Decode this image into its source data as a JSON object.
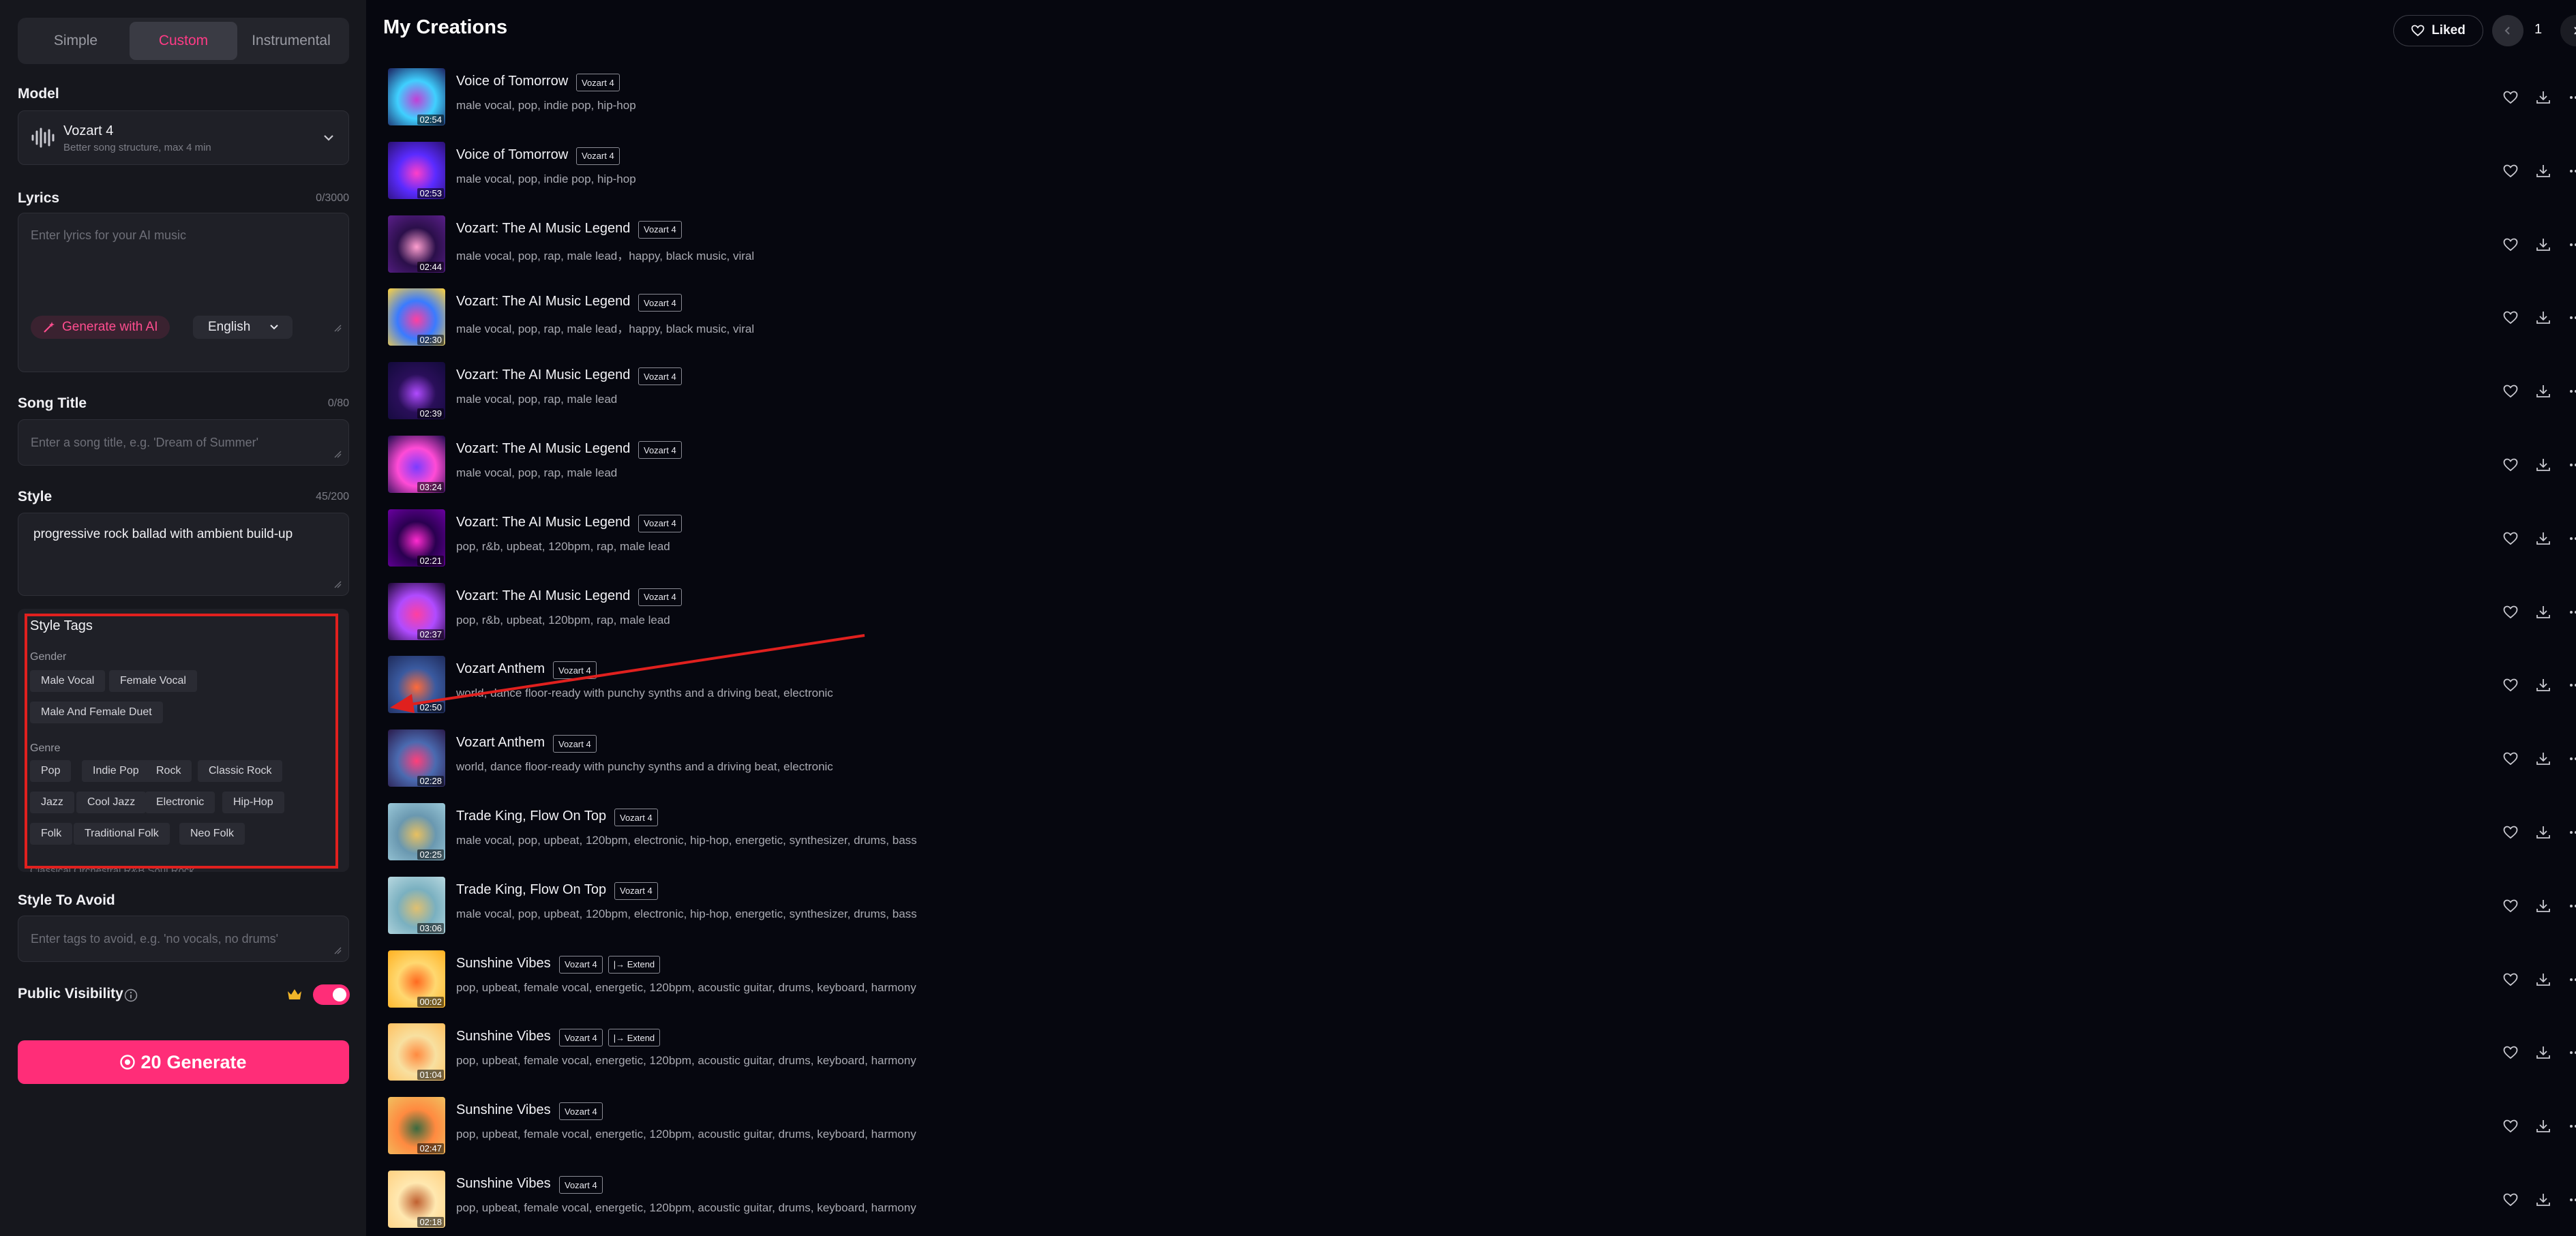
{
  "tabs": {
    "simple": "Simple",
    "custom": "Custom",
    "instrumental": "Instrumental"
  },
  "model": {
    "label": "Model",
    "name": "Vozart 4",
    "description": "Better song structure, max 4 min"
  },
  "lyrics": {
    "label": "Lyrics",
    "count": "0/3000",
    "placeholder": "Enter lyrics for your AI music",
    "generate_label": "Generate with AI",
    "language": "English"
  },
  "song_title": {
    "label": "Song Title",
    "count": "0/80",
    "placeholder": "Enter a song title, e.g. 'Dream of Summer'"
  },
  "style": {
    "label": "Style",
    "count": "45/200",
    "value": "progressive rock ballad with ambient build-up"
  },
  "style_tags": {
    "title": "Style Tags",
    "gender_label": "Gender",
    "gender": [
      "Male Vocal",
      "Female Vocal",
      "Male And Female Duet"
    ],
    "genre_label": "Genre",
    "genre": [
      "Pop",
      "Indie Pop",
      "Rock",
      "Classic Rock",
      "Jazz",
      "Cool Jazz",
      "Electronic",
      "Hip-Hop",
      "Folk",
      "Traditional Folk",
      "Neo Folk"
    ],
    "cut_off": "Classical   Orchestral   R&B   Soul   Rock"
  },
  "style_avoid": {
    "label": "Style To Avoid",
    "placeholder": "Enter tags to avoid, e.g. 'no vocals, no drums'"
  },
  "visibility": {
    "label": "Public Visibility",
    "enabled": true
  },
  "generate": {
    "credits": "20",
    "label": "Generate"
  },
  "main": {
    "title": "My Creations",
    "liked_label": "Liked",
    "page": "1"
  },
  "colors": {
    "accent": "#ff2d78",
    "highlight_box": "#e0201e"
  },
  "songs": [
    {
      "title": "Voice of Tomorrow",
      "badges": [
        "Vozart 4"
      ],
      "tags": "male vocal, pop, indie pop, hip-hop",
      "duration": "02:54"
    },
    {
      "title": "Voice of Tomorrow",
      "badges": [
        "Vozart 4"
      ],
      "tags": "male vocal, pop, indie pop, hip-hop",
      "duration": "02:53"
    },
    {
      "title": "Vozart: The AI Music Legend",
      "badges": [
        "Vozart 4"
      ],
      "tags": "male vocal, pop, rap, male lead，happy, black music, viral",
      "duration": "02:44"
    },
    {
      "title": "Vozart: The AI Music Legend",
      "badges": [
        "Vozart 4"
      ],
      "tags": "male vocal, pop, rap, male lead，happy, black music, viral",
      "duration": "02:30"
    },
    {
      "title": "Vozart: The AI Music Legend",
      "badges": [
        "Vozart 4"
      ],
      "tags": "male vocal, pop, rap, male lead",
      "duration": "02:39"
    },
    {
      "title": "Vozart: The AI Music Legend",
      "badges": [
        "Vozart 4"
      ],
      "tags": "male vocal, pop, rap, male lead",
      "duration": "03:24"
    },
    {
      "title": "Vozart: The AI Music Legend",
      "badges": [
        "Vozart 4"
      ],
      "tags": "pop, r&b, upbeat, 120bpm, rap, male lead",
      "duration": "02:21"
    },
    {
      "title": "Vozart: The AI Music Legend",
      "badges": [
        "Vozart 4"
      ],
      "tags": "pop, r&b, upbeat, 120bpm, rap, male lead",
      "duration": "02:37"
    },
    {
      "title": "Vozart Anthem",
      "badges": [
        "Vozart 4"
      ],
      "tags": "world, dance floor-ready with punchy synths and a driving beat, electronic",
      "duration": "02:50"
    },
    {
      "title": "Vozart Anthem",
      "badges": [
        "Vozart 4"
      ],
      "tags": "world, dance floor-ready with punchy synths and a driving beat, electronic",
      "duration": "02:28"
    },
    {
      "title": "Trade King, Flow On Top",
      "badges": [
        "Vozart 4"
      ],
      "tags": "male vocal, pop, upbeat, 120bpm, electronic, hip-hop, energetic, synthesizer, drums, bass",
      "duration": "02:25"
    },
    {
      "title": "Trade King, Flow On Top",
      "badges": [
        "Vozart 4"
      ],
      "tags": "male vocal, pop, upbeat, 120bpm, electronic, hip-hop, energetic, synthesizer, drums, bass",
      "duration": "03:06"
    },
    {
      "title": "Sunshine Vibes",
      "badges": [
        "Vozart 4",
        "|→ Extend"
      ],
      "tags": "pop, upbeat, female vocal, energetic, 120bpm, acoustic guitar, drums, keyboard, harmony",
      "duration": "00:02"
    },
    {
      "title": "Sunshine Vibes",
      "badges": [
        "Vozart 4",
        "|→ Extend"
      ],
      "tags": "pop, upbeat, female vocal, energetic, 120bpm, acoustic guitar, drums, keyboard, harmony",
      "duration": "01:04"
    },
    {
      "title": "Sunshine Vibes",
      "badges": [
        "Vozart 4"
      ],
      "tags": "pop, upbeat, female vocal, energetic, 120bpm, acoustic guitar, drums, keyboard, harmony",
      "duration": "02:47"
    },
    {
      "title": "Sunshine Vibes",
      "badges": [
        "Vozart 4"
      ],
      "tags": "pop, upbeat, female vocal, energetic, 120bpm, acoustic guitar, drums, keyboard, harmony",
      "duration": "02:18"
    }
  ]
}
